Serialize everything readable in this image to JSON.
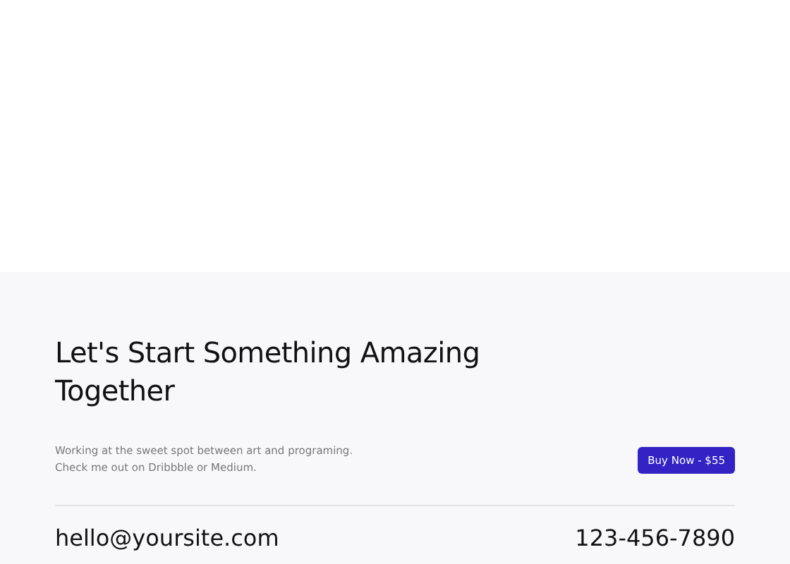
{
  "footer": {
    "heading_lines": [
      "Let's Start Something Amazing",
      "Together"
    ],
    "description_lines": [
      "Working at the sweet spot between art and programing.",
      "Check me out on Dribbble or Medium."
    ],
    "buy_button": "Buy Now - $55",
    "email": "hello@yoursite.com",
    "phone": "123-456-7890"
  }
}
